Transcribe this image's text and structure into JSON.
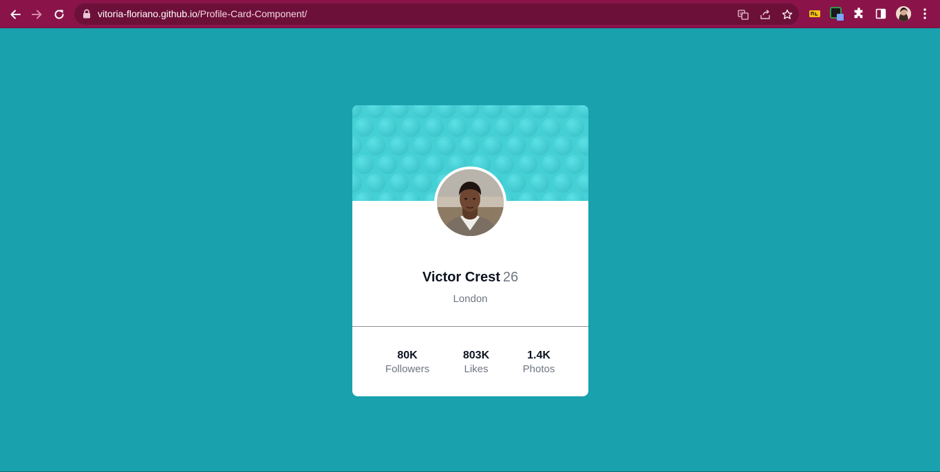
{
  "browser": {
    "url_host": "vitoria-floriano.github.io",
    "url_path": "/Profile-Card-Component/",
    "icons": [
      "back-arrow-icon",
      "forward-arrow-icon",
      "reload-icon",
      "lock-icon",
      "translate-icon",
      "share-icon",
      "star-icon",
      "extension-icon",
      "puzzle-icon",
      "side-panel-icon",
      "profile-avatar",
      "menu-dots-icon"
    ]
  },
  "page": {
    "background_color": "#19a1ae",
    "accent_color": "#45d0d6"
  },
  "profile": {
    "name": "Victor Crest",
    "age": "26",
    "city": "London"
  },
  "stats": [
    {
      "value": "80K",
      "label": "Followers"
    },
    {
      "value": "803K",
      "label": "Likes"
    },
    {
      "value": "1.4K",
      "label": "Photos"
    }
  ]
}
